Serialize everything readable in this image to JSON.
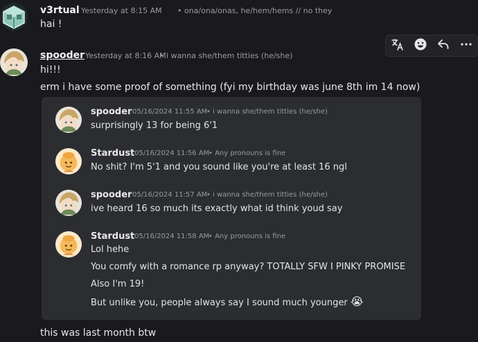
{
  "messages": [
    {
      "username": "v3rtual",
      "timestamp": "Yesterday at 8:15 AM",
      "pronouns": "• ona/ona/onas, he/hem/hems // no they",
      "lines": [
        "hai !"
      ]
    },
    {
      "username": "spooder",
      "timestamp": "Yesterday at 8:16 AM",
      "pronouns": "• i wanna she/them titties (he/she)",
      "lines": [
        "hi!!!",
        "erm i have some proof of something (fyi my birthday was june 8th im 14 now)"
      ]
    }
  ],
  "toolbar": {
    "icons": [
      "translate-icon",
      "emoji-icon",
      "reply-icon",
      "more-icon"
    ]
  },
  "embed": {
    "messages": [
      {
        "username": "spooder",
        "timestamp": "05/16/2024 11:55 AM",
        "pronouns": "• i wanna she/them titties (he/she)",
        "lines": [
          "surprisingly 13 for being 6'1"
        ]
      },
      {
        "username": "Stardust",
        "timestamp": "05/16/2024 11:56 AM",
        "pronouns": "• Any pronouns is fine",
        "lines": [
          "No shit? I'm 5'1 and you sound like you're at least 16 ngl"
        ]
      },
      {
        "username": "spooder",
        "timestamp": "05/16/2024 11:57 AM",
        "pronouns": "• i wanna she/them titties (he/she)",
        "lines": [
          "ive heard 16 so much its exactly what id think youd say"
        ]
      },
      {
        "username": "Stardust",
        "timestamp": "05/16/2024 11:58 AM",
        "pronouns": "• Any pronouns is fine",
        "lines": [
          "Lol hehe",
          "You comfy with a romance rp anyway? TOTALLY SFW I PINKY PROMISE",
          "Also I'm 19!",
          "But unlike you, people always say I sound much younger"
        ],
        "emoji": "😭"
      }
    ]
  },
  "footer_message": "this was last month btw",
  "colors": {
    "background": "#1a1a1e",
    "embed_bg": "#2b2d31",
    "username_default": "#f2f3f5",
    "meta": "#9a9ba1"
  }
}
